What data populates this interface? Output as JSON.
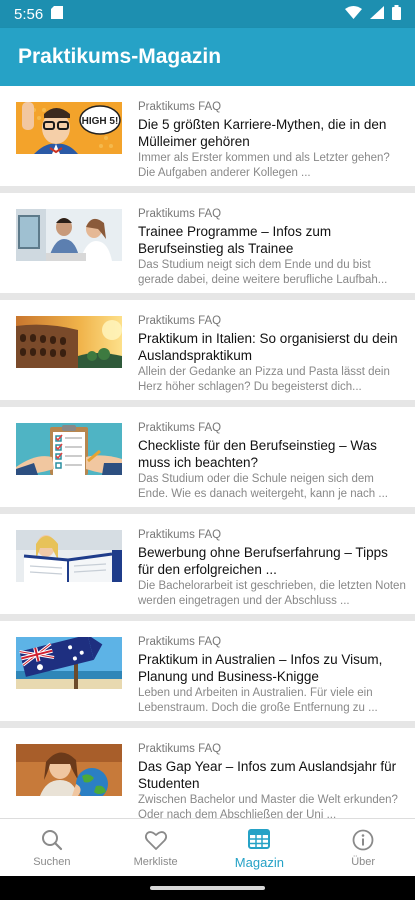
{
  "status": {
    "time": "5:56"
  },
  "app_bar": {
    "title": "Praktikums-Magazin"
  },
  "articles": [
    {
      "category": "Praktikums FAQ",
      "title": "Die 5 größten Karriere-Mythen, die in den Mülleimer gehören",
      "excerpt": "Immer als Erster kommen und als Letzter gehen? Die Aufgaben anderer Kollegen ...",
      "thumb_text": "HIGH 5!"
    },
    {
      "category": "Praktikums FAQ",
      "title": "Trainee Programme – Infos zum Berufseinstieg als Trainee",
      "excerpt": "Das Studium neigt sich dem Ende und du bist gerade dabei, deine weitere berufliche Laufbah..."
    },
    {
      "category": "Praktikums FAQ",
      "title": "Praktikum in Italien: So organisierst du dein Auslandspraktikum",
      "excerpt": "Allein der Gedanke an Pizza und Pasta lässt dein Herz höher schlagen? Du begeisterst dich..."
    },
    {
      "category": "Praktikums FAQ",
      "title": "Checkliste für den Berufseinstieg – Was muss ich beachten?",
      "excerpt": "Das Studium oder die Schule neigen sich dem Ende. Wie es danach weitergeht, kann je nach ..."
    },
    {
      "category": "Praktikums FAQ",
      "title": "Bewerbung ohne Berufserfahrung – Tipps für den erfolgreichen ...",
      "excerpt": "Die Bachelorarbeit ist geschrieben, die letzten Noten werden eingetragen und der Abschluss ..."
    },
    {
      "category": "Praktikums FAQ",
      "title": "Praktikum in Australien – Infos zu Visum, Planung und Business-Knigge",
      "excerpt": "Leben und Arbeiten in Australien. Für viele ein Lebenstraum. Doch die große Entfernung zu ..."
    },
    {
      "category": "Praktikums FAQ",
      "title": "Das Gap Year – Infos zum Auslandsjahr für Studenten",
      "excerpt": "Zwischen Bachelor und Master die Welt erkunden? Oder nach dem Abschließen der Uni ..."
    }
  ],
  "bottom_nav": {
    "search": "Suchen",
    "watchlist": "Merkliste",
    "magazine": "Magazin",
    "about": "Über"
  },
  "colors": {
    "accent": "#26a2c6",
    "status_bar": "#1d8fb0",
    "inactive": "#8a8a8a"
  }
}
